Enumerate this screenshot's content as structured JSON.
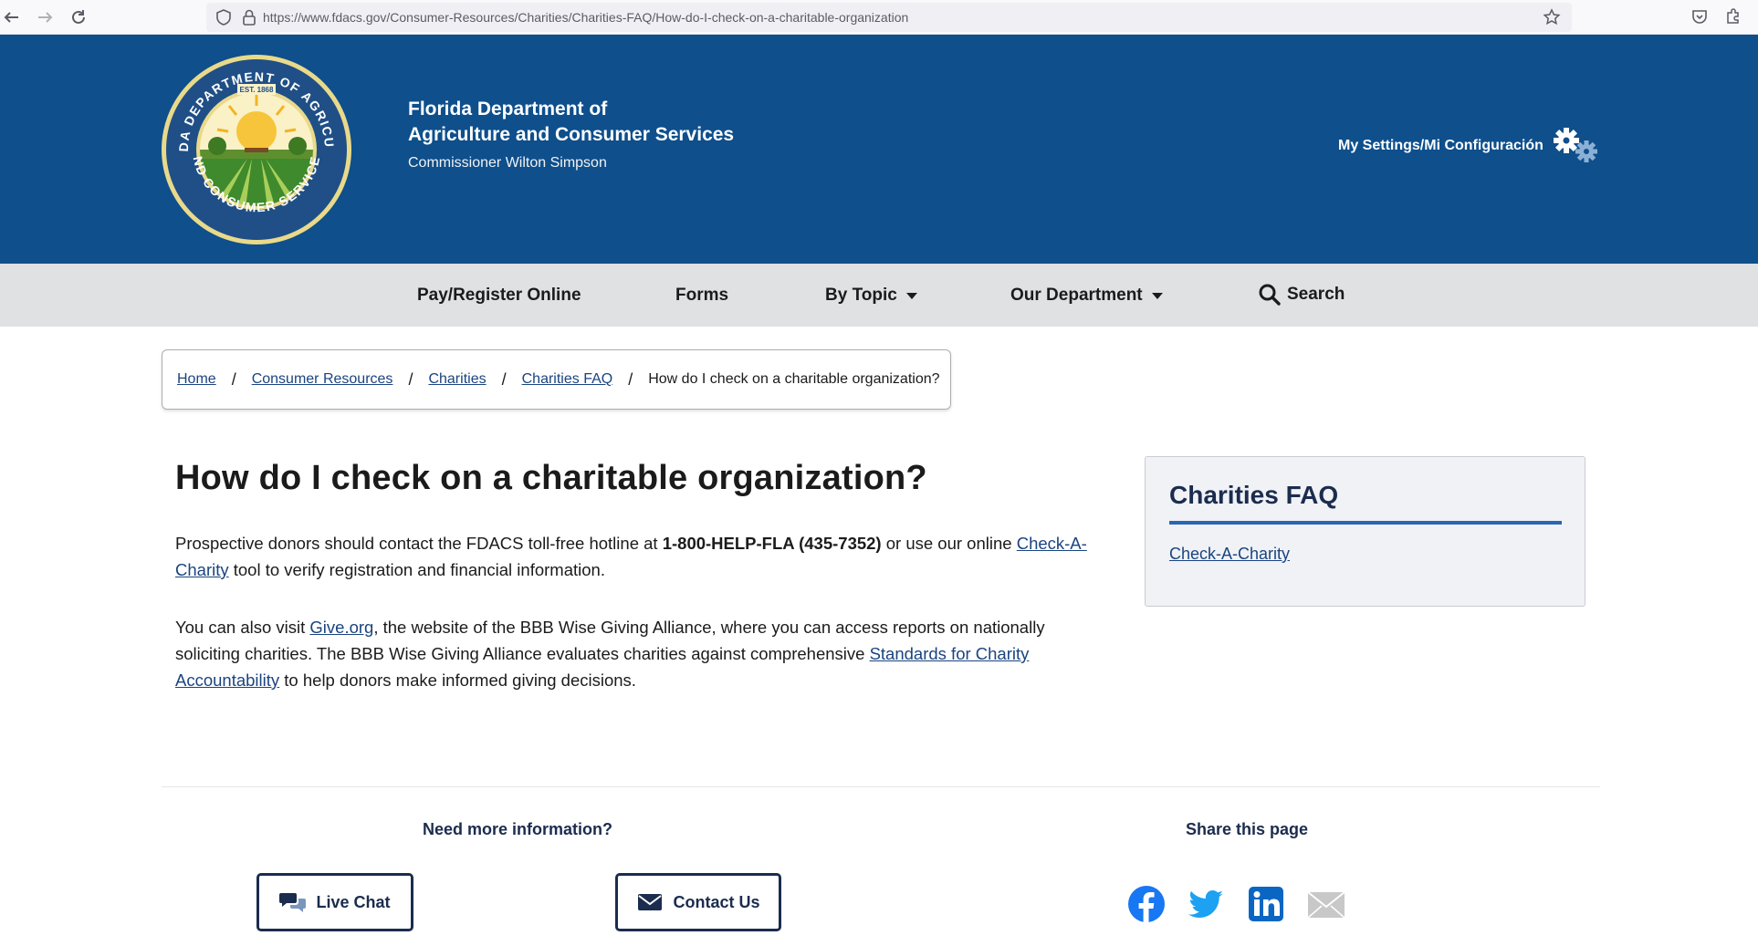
{
  "browser": {
    "url": "https://www.fdacs.gov/Consumer-Resources/Charities/Charities-FAQ/How-do-I-check-on-a-charitable-organization"
  },
  "header": {
    "agency_line1": "Florida Department of",
    "agency_line2": "Agriculture and Consumer Services",
    "commissioner": "Commissioner Wilton Simpson",
    "settings_label": "My Settings/Mi Configuración",
    "seal": {
      "ring_text_top": "FLORIDA DEPARTMENT OF AGRICULTURE",
      "ring_text_bottom": "AND CONSUMER SERVICES",
      "est": "EST. 1868"
    }
  },
  "nav": {
    "items": [
      {
        "label": "Pay/Register Online"
      },
      {
        "label": "Forms"
      },
      {
        "label": "By Topic"
      },
      {
        "label": "Our Department"
      },
      {
        "label": "Search"
      }
    ]
  },
  "breadcrumb": {
    "items": [
      {
        "label": "Home"
      },
      {
        "label": "Consumer Resources"
      },
      {
        "label": "Charities"
      },
      {
        "label": "Charities FAQ"
      }
    ],
    "current": "How do I check on a charitable organization?"
  },
  "main": {
    "title": "How do I check on a charitable organization?",
    "p1_a": "Prospective donors should contact the FDACS toll-free hotline at ",
    "p1_hotline": "1-800-HELP-FLA (435-7352)",
    "p1_b": " or use our online ",
    "p1_link": "Check-A-Charity",
    "p1_c": " tool to verify registration and financial information.",
    "p2_a": "You can also visit ",
    "p2_link1": "Give.org",
    "p2_b": ", the website of the BBB Wise Giving Alliance, where you can access reports on nationally soliciting charities. The BBB Wise Giving Alliance evaluates charities against comprehensive ",
    "p2_link2": "Standards for Charity Accountability",
    "p2_c": " to help donors make informed giving decisions."
  },
  "sidebar": {
    "title": "Charities FAQ",
    "link": "Check-A-Charity"
  },
  "footer": {
    "need_more": "Need more information?",
    "live_chat": "Live Chat",
    "contact_us": "Contact Us",
    "share_title": "Share this page",
    "social": [
      "facebook-icon",
      "twitter-icon",
      "linkedin-icon",
      "email-icon"
    ]
  },
  "colors": {
    "header_blue": "#0e4f8c",
    "nav_gray": "#dfe1e2",
    "link_blue": "#1a4480",
    "dark_navy": "#1b2c4e",
    "facebook": "#1877f2",
    "twitter": "#1da1f2",
    "linkedin": "#0a66c2"
  }
}
